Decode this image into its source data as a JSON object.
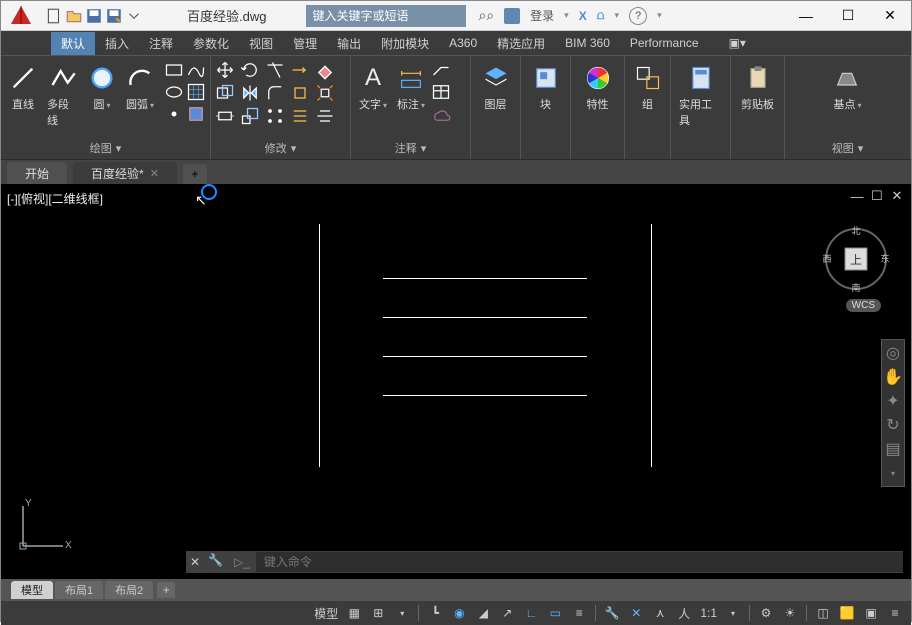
{
  "title": "百度经验.dwg",
  "search_placeholder": "键入关键字或短语",
  "login_label": "登录",
  "ribbon_tabs": [
    "默认",
    "插入",
    "注释",
    "参数化",
    "视图",
    "管理",
    "输出",
    "附加模块",
    "A360",
    "精选应用",
    "BIM 360",
    "Performance"
  ],
  "active_ribbon_tab": 0,
  "panels": {
    "draw": {
      "title": "绘图",
      "line": "直线",
      "polyline": "多段线",
      "circle": "圆",
      "arc": "圆弧"
    },
    "modify": {
      "title": "修改"
    },
    "annotate": {
      "title": "注释",
      "text": "文字",
      "dim": "标注"
    },
    "layers": {
      "title": "图层"
    },
    "block": {
      "title": "块"
    },
    "props": {
      "title": "特性"
    },
    "group": {
      "title": "组"
    },
    "utils": {
      "title": "实用工具"
    },
    "clip": {
      "title": "剪贴板"
    },
    "view": {
      "title": "视图",
      "base": "基点"
    }
  },
  "file_tabs": [
    {
      "label": "开始",
      "closable": false,
      "active": false
    },
    {
      "label": "百度经验*",
      "closable": true,
      "active": true
    }
  ],
  "view_label": "[-][俯视][二维线框]",
  "wcs_label": "WCS",
  "viewcube": {
    "top": "上",
    "n": "北",
    "s": "南",
    "e": "东",
    "w": "西"
  },
  "cmd_placeholder": "键入命令",
  "layout_tabs": [
    "模型",
    "布局1",
    "布局2"
  ],
  "active_layout_tab": 0,
  "status": {
    "model": "模型",
    "scale": "1:1",
    "y_label": "Y",
    "x_label": "X"
  },
  "icons": {
    "help": "?",
    "minimize": "—",
    "maximize": "☐",
    "close": "✕"
  }
}
